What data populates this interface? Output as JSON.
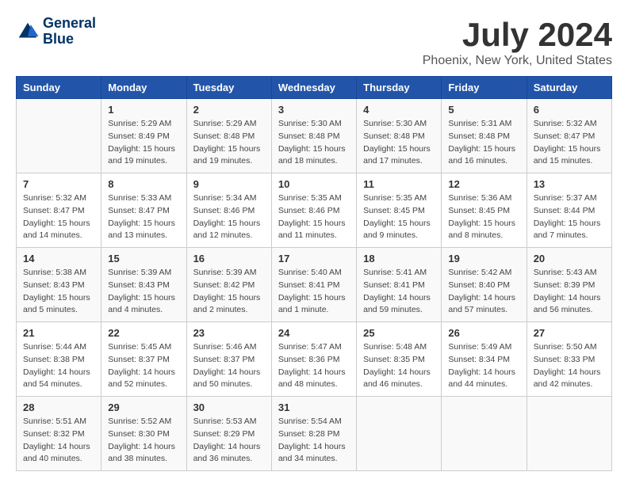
{
  "header": {
    "logo_line1": "General",
    "logo_line2": "Blue",
    "title": "July 2024",
    "subtitle": "Phoenix, New York, United States"
  },
  "calendar": {
    "days_of_week": [
      "Sunday",
      "Monday",
      "Tuesday",
      "Wednesday",
      "Thursday",
      "Friday",
      "Saturday"
    ],
    "weeks": [
      [
        {
          "day": "",
          "info": ""
        },
        {
          "day": "1",
          "info": "Sunrise: 5:29 AM\nSunset: 8:49 PM\nDaylight: 15 hours\nand 19 minutes."
        },
        {
          "day": "2",
          "info": "Sunrise: 5:29 AM\nSunset: 8:48 PM\nDaylight: 15 hours\nand 19 minutes."
        },
        {
          "day": "3",
          "info": "Sunrise: 5:30 AM\nSunset: 8:48 PM\nDaylight: 15 hours\nand 18 minutes."
        },
        {
          "day": "4",
          "info": "Sunrise: 5:30 AM\nSunset: 8:48 PM\nDaylight: 15 hours\nand 17 minutes."
        },
        {
          "day": "5",
          "info": "Sunrise: 5:31 AM\nSunset: 8:48 PM\nDaylight: 15 hours\nand 16 minutes."
        },
        {
          "day": "6",
          "info": "Sunrise: 5:32 AM\nSunset: 8:47 PM\nDaylight: 15 hours\nand 15 minutes."
        }
      ],
      [
        {
          "day": "7",
          "info": "Sunrise: 5:32 AM\nSunset: 8:47 PM\nDaylight: 15 hours\nand 14 minutes."
        },
        {
          "day": "8",
          "info": "Sunrise: 5:33 AM\nSunset: 8:47 PM\nDaylight: 15 hours\nand 13 minutes."
        },
        {
          "day": "9",
          "info": "Sunrise: 5:34 AM\nSunset: 8:46 PM\nDaylight: 15 hours\nand 12 minutes."
        },
        {
          "day": "10",
          "info": "Sunrise: 5:35 AM\nSunset: 8:46 PM\nDaylight: 15 hours\nand 11 minutes."
        },
        {
          "day": "11",
          "info": "Sunrise: 5:35 AM\nSunset: 8:45 PM\nDaylight: 15 hours\nand 9 minutes."
        },
        {
          "day": "12",
          "info": "Sunrise: 5:36 AM\nSunset: 8:45 PM\nDaylight: 15 hours\nand 8 minutes."
        },
        {
          "day": "13",
          "info": "Sunrise: 5:37 AM\nSunset: 8:44 PM\nDaylight: 15 hours\nand 7 minutes."
        }
      ],
      [
        {
          "day": "14",
          "info": "Sunrise: 5:38 AM\nSunset: 8:43 PM\nDaylight: 15 hours\nand 5 minutes."
        },
        {
          "day": "15",
          "info": "Sunrise: 5:39 AM\nSunset: 8:43 PM\nDaylight: 15 hours\nand 4 minutes."
        },
        {
          "day": "16",
          "info": "Sunrise: 5:39 AM\nSunset: 8:42 PM\nDaylight: 15 hours\nand 2 minutes."
        },
        {
          "day": "17",
          "info": "Sunrise: 5:40 AM\nSunset: 8:41 PM\nDaylight: 15 hours\nand 1 minute."
        },
        {
          "day": "18",
          "info": "Sunrise: 5:41 AM\nSunset: 8:41 PM\nDaylight: 14 hours\nand 59 minutes."
        },
        {
          "day": "19",
          "info": "Sunrise: 5:42 AM\nSunset: 8:40 PM\nDaylight: 14 hours\nand 57 minutes."
        },
        {
          "day": "20",
          "info": "Sunrise: 5:43 AM\nSunset: 8:39 PM\nDaylight: 14 hours\nand 56 minutes."
        }
      ],
      [
        {
          "day": "21",
          "info": "Sunrise: 5:44 AM\nSunset: 8:38 PM\nDaylight: 14 hours\nand 54 minutes."
        },
        {
          "day": "22",
          "info": "Sunrise: 5:45 AM\nSunset: 8:37 PM\nDaylight: 14 hours\nand 52 minutes."
        },
        {
          "day": "23",
          "info": "Sunrise: 5:46 AM\nSunset: 8:37 PM\nDaylight: 14 hours\nand 50 minutes."
        },
        {
          "day": "24",
          "info": "Sunrise: 5:47 AM\nSunset: 8:36 PM\nDaylight: 14 hours\nand 48 minutes."
        },
        {
          "day": "25",
          "info": "Sunrise: 5:48 AM\nSunset: 8:35 PM\nDaylight: 14 hours\nand 46 minutes."
        },
        {
          "day": "26",
          "info": "Sunrise: 5:49 AM\nSunset: 8:34 PM\nDaylight: 14 hours\nand 44 minutes."
        },
        {
          "day": "27",
          "info": "Sunrise: 5:50 AM\nSunset: 8:33 PM\nDaylight: 14 hours\nand 42 minutes."
        }
      ],
      [
        {
          "day": "28",
          "info": "Sunrise: 5:51 AM\nSunset: 8:32 PM\nDaylight: 14 hours\nand 40 minutes."
        },
        {
          "day": "29",
          "info": "Sunrise: 5:52 AM\nSunset: 8:30 PM\nDaylight: 14 hours\nand 38 minutes."
        },
        {
          "day": "30",
          "info": "Sunrise: 5:53 AM\nSunset: 8:29 PM\nDaylight: 14 hours\nand 36 minutes."
        },
        {
          "day": "31",
          "info": "Sunrise: 5:54 AM\nSunset: 8:28 PM\nDaylight: 14 hours\nand 34 minutes."
        },
        {
          "day": "",
          "info": ""
        },
        {
          "day": "",
          "info": ""
        },
        {
          "day": "",
          "info": ""
        }
      ]
    ]
  }
}
